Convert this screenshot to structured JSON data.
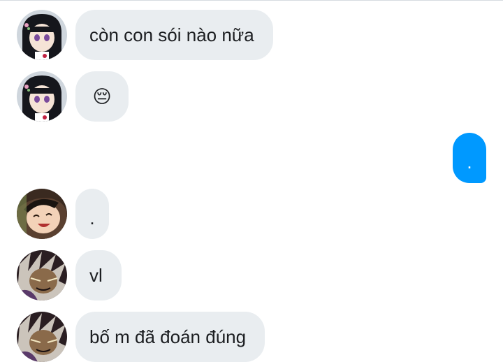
{
  "conversation": {
    "messages": [
      {
        "direction": "incoming",
        "sender_avatar": "anime-girl-black-hair-avatar",
        "text": "còn con sói nào nữa"
      },
      {
        "direction": "incoming",
        "sender_avatar": "anime-girl-black-hair-avatar",
        "text": "😔"
      },
      {
        "direction": "outgoing",
        "text": "."
      },
      {
        "direction": "incoming",
        "sender_avatar": "anime-boy-laughing-avatar",
        "text": "."
      },
      {
        "direction": "incoming",
        "sender_avatar": "anime-dark-character-avatar",
        "text": "vl"
      },
      {
        "direction": "incoming",
        "sender_avatar": "anime-dark-character-avatar",
        "text": "bố m đã đoán đúng"
      }
    ]
  },
  "colors": {
    "incoming_bubble": "#e9edf0",
    "outgoing_bubble": "#0099ff",
    "text": "#1c1e21"
  }
}
